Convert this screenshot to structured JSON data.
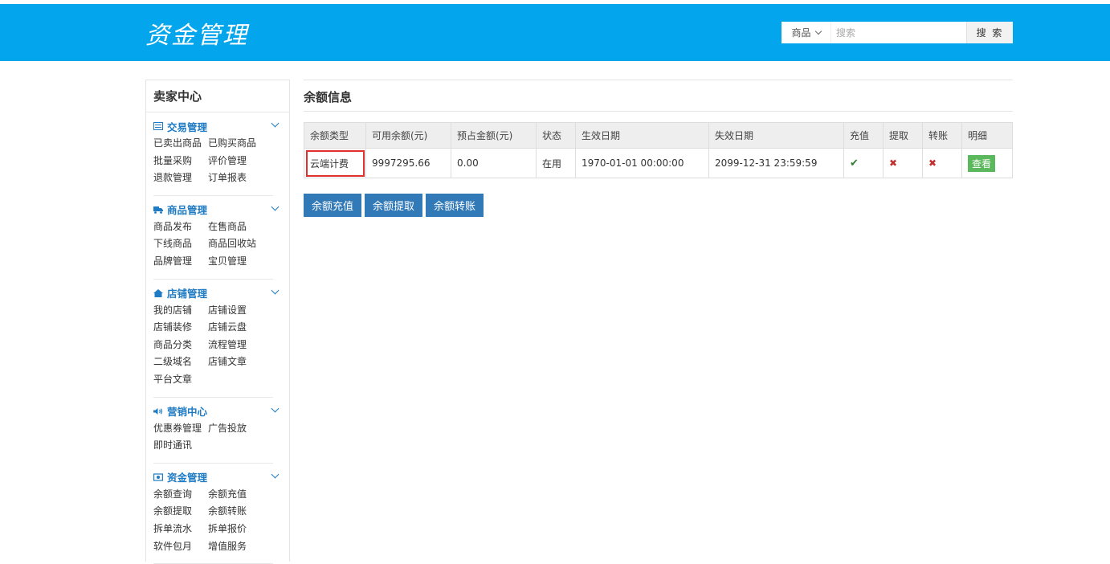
{
  "header": {
    "logo": "资金管理",
    "search_category": "商品",
    "search_placeholder": "搜索",
    "search_button": "搜 索"
  },
  "sidebar": {
    "title": "卖家中心",
    "groups": [
      {
        "title": "交易管理",
        "icon": "list-icon",
        "items": [
          "已卖出商品",
          "已购买商品",
          "批量采购",
          "评价管理",
          "退款管理",
          "订单报表"
        ]
      },
      {
        "title": "商品管理",
        "icon": "truck-icon",
        "items": [
          "商品发布",
          "在售商品",
          "下线商品",
          "商品回收站",
          "品牌管理",
          "宝贝管理"
        ]
      },
      {
        "title": "店铺管理",
        "icon": "home-icon",
        "items": [
          "我的店铺",
          "店铺设置",
          "店铺装修",
          "店铺云盘",
          "商品分类",
          "流程管理",
          "二级域名",
          "店铺文章",
          "平台文章"
        ]
      },
      {
        "title": "营销中心",
        "icon": "volume-icon",
        "items": [
          "优惠券管理",
          "广告投放",
          "即时通讯"
        ]
      },
      {
        "title": "资金管理",
        "icon": "money-icon",
        "items": [
          "余额查询",
          "余额充值",
          "余额提取",
          "余额转账",
          "拆单流水",
          "拆单报价",
          "软件包月",
          "增值服务"
        ]
      }
    ]
  },
  "main": {
    "title": "余额信息",
    "columns": [
      "余额类型",
      "可用余额(元)",
      "预占金额(元)",
      "状态",
      "生效日期",
      "失效日期",
      "充值",
      "提取",
      "转账",
      "明细"
    ],
    "rows": [
      {
        "type": "云端计费",
        "available": "9997295.66",
        "reserved": "0.00",
        "status": "在用",
        "start": "1970-01-01 00:00:00",
        "end": "2099-12-31 23:59:59",
        "recharge": "check-icon",
        "withdraw": "cross-icon",
        "transfer": "cross-icon",
        "detail": "查看"
      }
    ],
    "actions": [
      "余额充值",
      "余额提取",
      "余额转账"
    ]
  },
  "colors": {
    "header": "#03a6ec",
    "accent": "#1e7bc4",
    "button": "#3179b7",
    "view": "#5cb85c",
    "highlight": "#e0302b"
  }
}
